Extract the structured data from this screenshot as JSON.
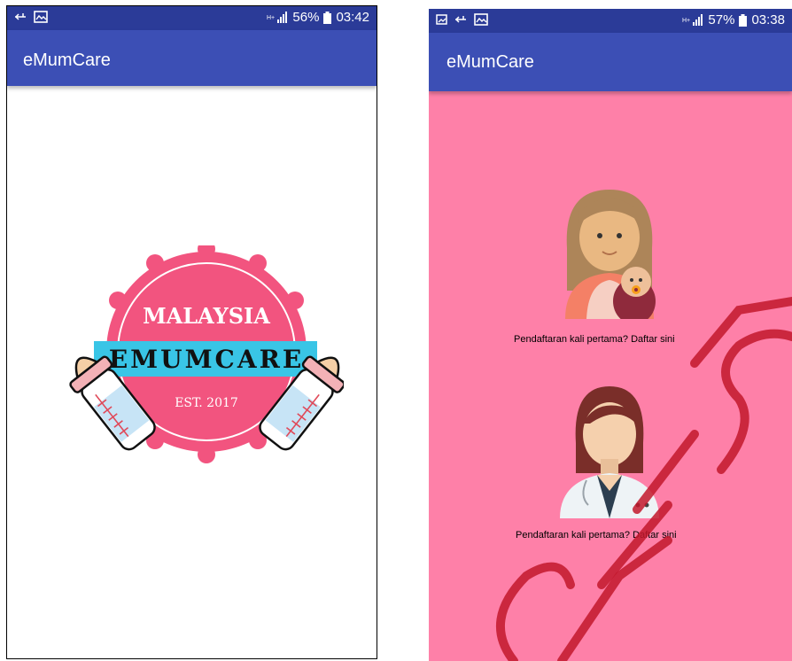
{
  "left_screen": {
    "status": {
      "icons": [
        "usb-icon",
        "image-icon"
      ],
      "network": "»",
      "battery": "56%",
      "time": "03:42"
    },
    "app_title": "eMumCare",
    "logo": {
      "top_text": "MALAYSIA",
      "banner_text": "EMUMCARE",
      "bottom_text": "EST. 2017"
    }
  },
  "right_screen": {
    "status": {
      "battery": "57%",
      "time": "03:38"
    },
    "app_title": "eMumCare",
    "options": [
      {
        "label": "Pendaftaran kali pertama? Daftar sini",
        "icon": "mother-baby-icon"
      },
      {
        "label": "Pendaftaran kali pertama? Daftar sini",
        "icon": "doctor-icon"
      }
    ]
  },
  "colors": {
    "status_bar": "#2b3b98",
    "app_bar": "#3c4fb5",
    "pink_bg": "#fe80a8",
    "badge_pink": "#f2547f",
    "banner_cyan": "#39c5e6"
  }
}
